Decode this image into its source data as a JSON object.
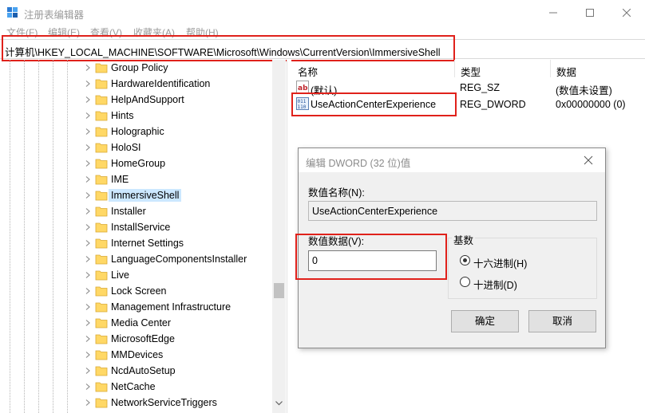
{
  "window": {
    "title": "注册表编辑器",
    "controls": {
      "minimize_icon": "minimize-icon",
      "maximize_icon": "maximize-icon",
      "close_icon": "close-icon"
    }
  },
  "menu": [
    "文件(F)",
    "编辑(E)",
    "查看(V)",
    "收藏夹(A)",
    "帮助(H)"
  ],
  "address": {
    "path": "计算机\\HKEY_LOCAL_MACHINE\\SOFTWARE\\Microsoft\\Windows\\CurrentVersion\\ImmersiveShell"
  },
  "tree": {
    "items": [
      {
        "label": "Group Policy",
        "selected": false
      },
      {
        "label": "HardwareIdentification",
        "selected": false
      },
      {
        "label": "HelpAndSupport",
        "selected": false
      },
      {
        "label": "Hints",
        "selected": false
      },
      {
        "label": "Holographic",
        "selected": false
      },
      {
        "label": "HoloSI",
        "selected": false
      },
      {
        "label": "HomeGroup",
        "selected": false
      },
      {
        "label": "IME",
        "selected": false
      },
      {
        "label": "ImmersiveShell",
        "selected": true
      },
      {
        "label": "Installer",
        "selected": false
      },
      {
        "label": "InstallService",
        "selected": false
      },
      {
        "label": "Internet Settings",
        "selected": false
      },
      {
        "label": "LanguageComponentsInstaller",
        "selected": false
      },
      {
        "label": "Live",
        "selected": false
      },
      {
        "label": "Lock Screen",
        "selected": false
      },
      {
        "label": "Management Infrastructure",
        "selected": false
      },
      {
        "label": "Media Center",
        "selected": false
      },
      {
        "label": "MicrosoftEdge",
        "selected": false
      },
      {
        "label": "MMDevices",
        "selected": false
      },
      {
        "label": "NcdAutoSetup",
        "selected": false
      },
      {
        "label": "NetCache",
        "selected": false
      },
      {
        "label": "NetworkServiceTriggers",
        "selected": false
      }
    ]
  },
  "list": {
    "headers": {
      "name": "名称",
      "type": "类型",
      "data": "数据"
    },
    "rows": [
      {
        "icon": "string-value-icon",
        "name": "(默认)",
        "type": "REG_SZ",
        "data": "(数值未设置)"
      },
      {
        "icon": "dword-value-icon",
        "name": "UseActionCenterExperience",
        "type": "REG_DWORD",
        "data": "0x00000000 (0)"
      }
    ]
  },
  "dialog": {
    "title": "编辑 DWORD (32 位)值",
    "value_name_label": "数值名称(N):",
    "value_name": "UseActionCenterExperience",
    "value_data_label": "数值数据(V):",
    "value_data": "0",
    "base_label": "基数",
    "radio_hex": "十六进制(H)",
    "radio_dec": "十进制(D)",
    "base_selected": "hex",
    "ok": "确定",
    "cancel": "取消"
  },
  "colors": {
    "highlight": "#e0211b",
    "selection": "#cce8ff",
    "folder": "#ffd866"
  }
}
